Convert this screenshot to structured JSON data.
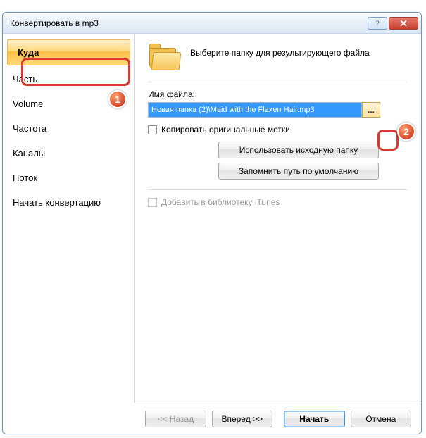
{
  "title": "Конвертировать в mp3",
  "sidebar": {
    "items": [
      {
        "label": "Куда",
        "active": true
      },
      {
        "label": "Часть"
      },
      {
        "label": "Volume"
      },
      {
        "label": "Частота"
      },
      {
        "label": "Каналы"
      },
      {
        "label": "Поток"
      },
      {
        "label": "Начать конвертацию"
      }
    ]
  },
  "main": {
    "instruction": "Выберите папку для результирующего файла",
    "file_label": "Имя файла:",
    "file_value": "Новая папка (2)\\Maid with the Flaxen Hair.mp3",
    "browse_label": "...",
    "copy_tags": "Копировать оригинальные метки",
    "use_source": "Использовать исходную папку",
    "remember_path": "Запомнить путь по умолчанию",
    "add_itunes": "Добавить в библиотеку iTunes"
  },
  "footer": {
    "back": "<< Назад",
    "next": "Вперед >>",
    "start": "Начать",
    "cancel": "Отмена"
  },
  "annot": {
    "a1": "1",
    "a2": "2"
  }
}
